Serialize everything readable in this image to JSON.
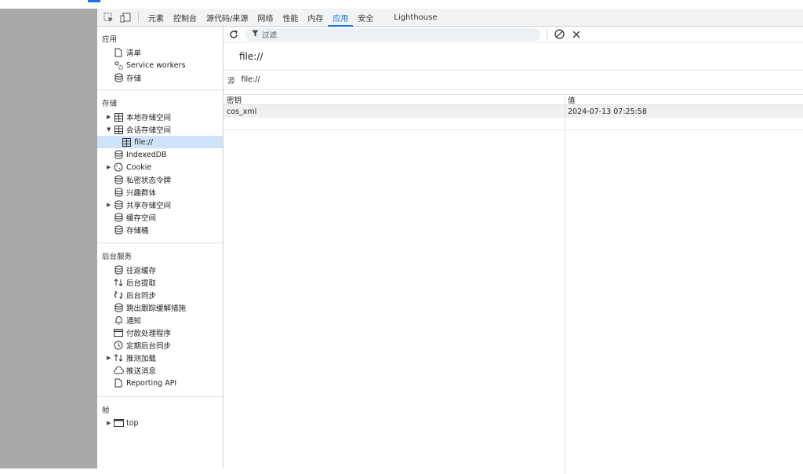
{
  "toolbar": {
    "tabs": [
      "元素",
      "控制台",
      "源代码/来源",
      "网络",
      "性能",
      "内存",
      "应用",
      "安全",
      "Lighthouse"
    ],
    "active_tab": "应用"
  },
  "sidebar": {
    "application": {
      "title": "应用",
      "items": [
        "清单",
        "Service workers",
        "存储"
      ]
    },
    "storage": {
      "title": "存储",
      "items": [
        "本地存储空间",
        "会话存储空间",
        "file://",
        "IndexedDB",
        "Cookie",
        "私密状态令牌",
        "兴趣群体",
        "共享存储空间",
        "缓存空间",
        "存储桶"
      ]
    },
    "background": {
      "title": "后台服务",
      "items": [
        "往返缓存",
        "后台提取",
        "后台同步",
        "跳出跟踪缓解措施",
        "通知",
        "付款处理程序",
        "定期后台同步",
        "推测加载",
        "推送消息",
        "Reporting API"
      ]
    },
    "frames": {
      "title": "帧",
      "items": [
        "top"
      ]
    }
  },
  "main": {
    "filter_placeholder": "过滤",
    "origin_title": "file://",
    "origin_label": "源",
    "origin_value": "file://",
    "table": {
      "headers": [
        "密钥",
        "值"
      ],
      "rows": [
        {
          "key": "cos_xml",
          "value": "2024-07-13 07:25:58"
        }
      ]
    }
  },
  "colors": {
    "accent": "#1a73e8",
    "selected_bg": "#cfe3fb",
    "gutter": "#a9a9a9"
  }
}
